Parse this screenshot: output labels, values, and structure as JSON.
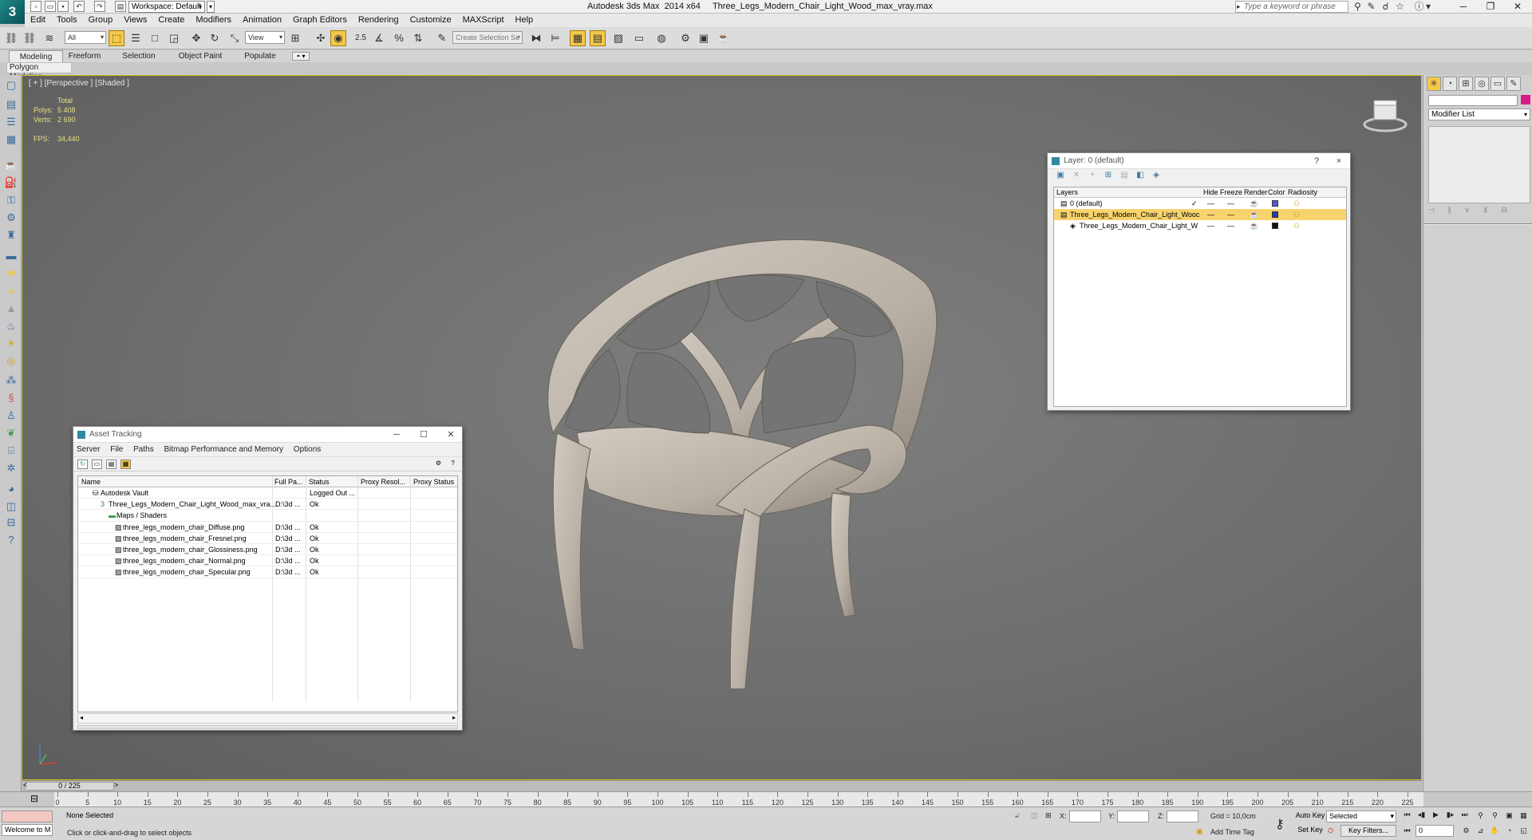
{
  "app": {
    "title": "Autodesk 3ds Max  2014 x64     Three_Legs_Modern_Chair_Light_Wood_max_vray.max",
    "logo_text": "3",
    "workspace": "Workspace: Default",
    "search_placeholder": "Type a keyword or phrase"
  },
  "menu": [
    "Edit",
    "Tools",
    "Group",
    "Views",
    "Create",
    "Modifiers",
    "Animation",
    "Graph Editors",
    "Rendering",
    "Customize",
    "MAXScript",
    "Help"
  ],
  "toolbar": {
    "filter": "All",
    "ref_coord": "View",
    "selection_set": "Create Selection Se",
    "snap_label": "2.5"
  },
  "ribbon": {
    "tabs": [
      "Modeling",
      "Freeform",
      "Selection",
      "Object Paint",
      "Populate"
    ],
    "active_tab": "Modeling",
    "panel": "Polygon Modeling"
  },
  "viewport": {
    "label": "[ + ] [Perspective ] [Shaded ]",
    "stats": {
      "total": "Total",
      "polys_label": "Polys:",
      "polys": "5 408",
      "verts_label": "Verts:",
      "verts": "2 690",
      "fps_label": "FPS:",
      "fps": "34,440"
    },
    "chair_wood_color": "#b8b0a5"
  },
  "command_panel": {
    "modifier_list": "Modifier List",
    "object_color": "#d81b88"
  },
  "layer_window": {
    "title": "Layer: 0 (default)",
    "help_glyph": "?",
    "close_glyph": "×",
    "columns": {
      "layers": "Layers",
      "hide": "Hide",
      "freeze": "Freeze",
      "render": "Render",
      "color": "Color",
      "radiosity": "Radiosity"
    },
    "rows": [
      {
        "name": "0 (default)",
        "indent": 0,
        "selected": false,
        "active": true,
        "color": "#5a5ad8"
      },
      {
        "name": "Three_Legs_Modern_Chair_Light_Wooc",
        "indent": 0,
        "selected": true,
        "active": false,
        "color": "#1c3fa8"
      },
      {
        "name": "Three_Legs_Modern_Chair_Light_W",
        "indent": 1,
        "selected": false,
        "active": false,
        "color": "#111111"
      }
    ],
    "check_glyph": "✓"
  },
  "asset_window": {
    "title": "Asset Tracking",
    "menu": [
      "Server",
      "File",
      "Paths",
      "Bitmap Performance and Memory",
      "Options"
    ],
    "columns": {
      "name": "Name",
      "path": "Full Pa...",
      "status": "Status",
      "proxy_res": "Proxy Resol...",
      "proxy_status": "Proxy Status"
    },
    "rows": [
      {
        "name": "Autodesk Vault",
        "indent": 0,
        "icon": "vault-icon",
        "path": "",
        "status": "Logged Out ..."
      },
      {
        "name": "Three_Legs_Modern_Chair_Light_Wood_max_vra...",
        "indent": 1,
        "icon": "max-file-icon",
        "path": "D:\\3d ...",
        "status": "Ok"
      },
      {
        "name": "Maps / Shaders",
        "indent": 2,
        "icon": "maps-folder-icon",
        "path": "",
        "status": ""
      },
      {
        "name": "three_legs_modern_chair_Diffuse.png",
        "indent": 3,
        "icon": "bitmap-icon",
        "path": "D:\\3d ...",
        "status": "Ok"
      },
      {
        "name": "three_legs_modern_chair_Fresnel.png",
        "indent": 3,
        "icon": "bitmap-icon",
        "path": "D:\\3d ...",
        "status": "Ok"
      },
      {
        "name": "three_legs_modern_chair_Glossiness.png",
        "indent": 3,
        "icon": "bitmap-icon",
        "path": "D:\\3d ...",
        "status": "Ok"
      },
      {
        "name": "three_legs_modern_chair_Normal.png",
        "indent": 3,
        "icon": "bitmap-icon",
        "path": "D:\\3d ...",
        "status": "Ok"
      },
      {
        "name": "three_legs_modern_chair_Specular.png",
        "indent": 3,
        "icon": "bitmap-icon",
        "path": "D:\\3d ...",
        "status": "Ok"
      }
    ]
  },
  "timeline": {
    "frame_display": "0 / 225",
    "ticks": [
      0,
      5,
      10,
      15,
      20,
      25,
      30,
      35,
      40,
      45,
      50,
      55,
      60,
      65,
      70,
      75,
      80,
      85,
      90,
      95,
      100,
      105,
      110,
      115,
      120,
      125,
      130,
      135,
      140,
      145,
      150,
      155,
      160,
      165,
      170,
      175,
      180,
      185,
      190,
      195,
      200,
      205,
      210,
      215,
      220,
      225
    ]
  },
  "status": {
    "maxscript": "Welcome to M",
    "selection": "None Selected",
    "prompt": "Click or click-and-drag to select objects",
    "x_label": "X:",
    "y_label": "Y:",
    "z_label": "Z:",
    "grid": "Grid = 10,0cm",
    "add_time_tag": "Add Time Tag",
    "auto_key": "Auto Key",
    "set_key": "Set Key",
    "key_mode": "Selected",
    "key_filters": "Key Filters...",
    "current_frame": "0"
  }
}
